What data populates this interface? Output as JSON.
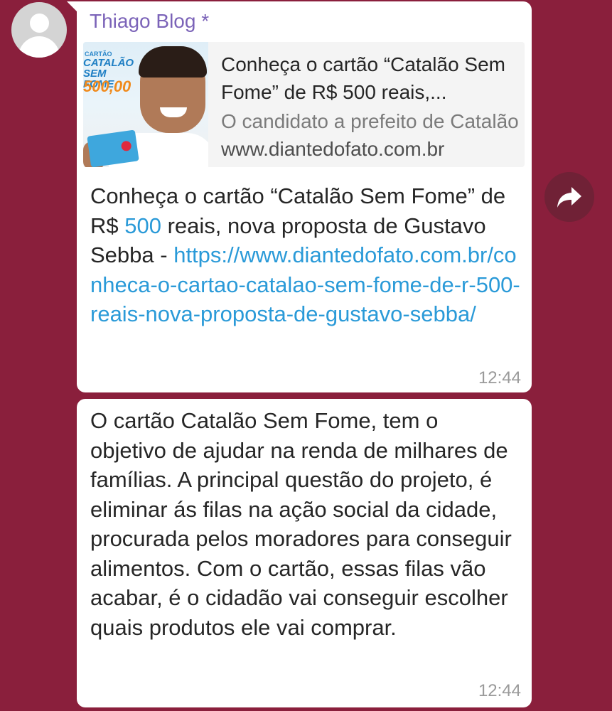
{
  "message1": {
    "sender": "Thiago Blog *",
    "preview": {
      "title": "Conheça o cartão “Catalão Sem Fome” de R$ 500 reais,...",
      "description": "O candidato a prefeito de Catalão",
      "domain": "www.diantedofato.com.br",
      "thumbnail_text": {
        "small": "CARTÃO",
        "brand": "CATALÃO SEM FOME",
        "amount": "500,00"
      }
    },
    "text_before_number": "Conheça o cartão “Catalão Sem Fome” de R$ ",
    "number": "500",
    "text_after_number": " reais, nova proposta de Gustavo Sebba - ",
    "link": "https://www.diantedofato.com.br/conheca-o-cartao-catalao-sem-fome-de-r-500-reais-nova-proposta-de-gustavo-sebba/",
    "time": "12:44"
  },
  "message2": {
    "text": "O cartão Catalão Sem Fome, tem o objetivo de ajudar na renda de milhares de famílias. A principal questão do projeto, é eliminar ás filas na ação social da cidade, procurada pelos moradores para conseguir alimentos. Com o cartão, essas filas vão acabar, é o cidadão vai conseguir escolher quais produtos ele vai comprar.",
    "time": "12:44"
  },
  "icons": {
    "avatar": "default-user-avatar",
    "share": "forward-arrow-icon"
  },
  "colors": {
    "background": "#8a1f3c",
    "sender_name": "#7b63b8",
    "link": "#2a9ad8",
    "bubble": "#ffffff"
  }
}
